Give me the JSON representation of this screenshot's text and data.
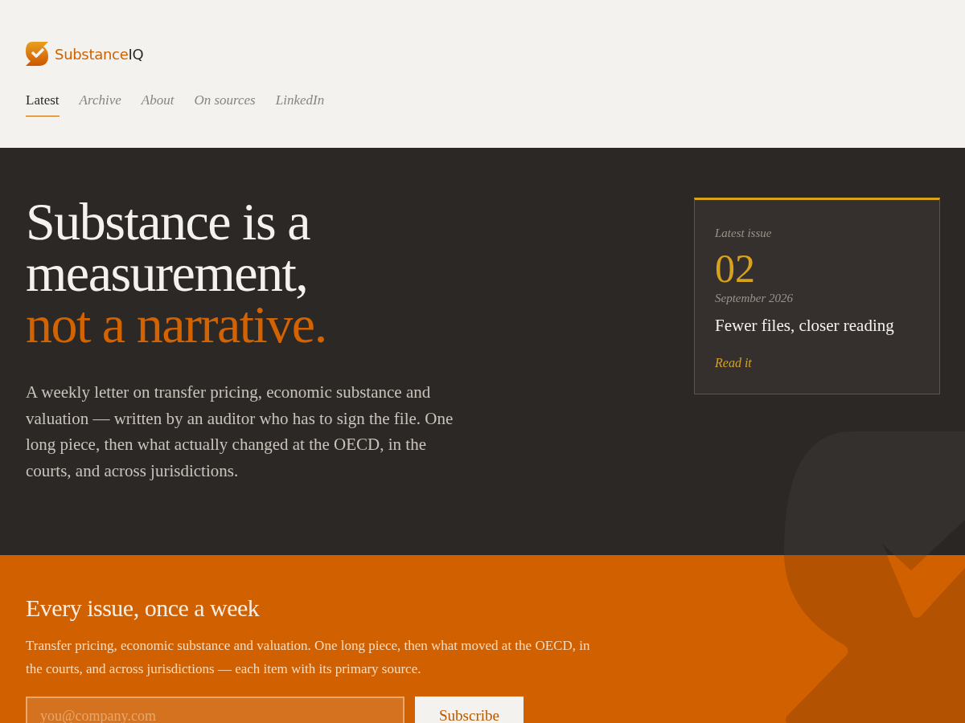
{
  "logo": {
    "name": "Substance",
    "suffix": "IQ"
  },
  "nav": [
    {
      "label": "Latest",
      "selected": true
    },
    {
      "label": "Archive",
      "selected": false
    },
    {
      "label": "About",
      "selected": false
    },
    {
      "label": "On sources",
      "selected": false
    },
    {
      "label": "LinkedIn",
      "selected": false
    }
  ],
  "hero": {
    "headline": [
      {
        "text": "Substance is a",
        "accent": false
      },
      {
        "text": "measurement,",
        "accent": false
      },
      {
        "text": "not a narrative.",
        "accent": true
      }
    ],
    "intro": "A weekly letter on transfer pricing, economic substance and valuation — written by an auditor who has to sign the file. One long piece, then what actually changed at the OECD, in the courts, and across jurisdictions."
  },
  "latest_issue": {
    "label": "Latest issue",
    "number": "02",
    "date": "September 2026",
    "title": "Fewer files, closer reading",
    "link": "Read it"
  },
  "subscribe": {
    "title": "Every issue, once a week",
    "text": "Transfer pricing, economic substance and valuation. One long piece, then what moved at the OECD, in the courts, and across jurisdictions — each item with its primary source.",
    "email": {
      "placeholder": "you@company.com"
    },
    "button": "Subscribe"
  }
}
